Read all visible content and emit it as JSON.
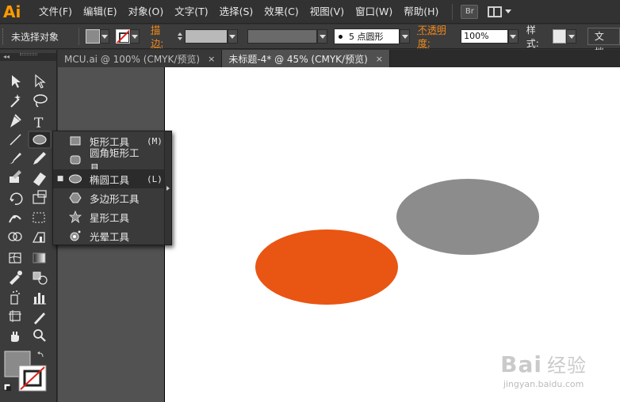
{
  "app": {
    "logo_text": "Ai",
    "accent_color": "#ff9a00"
  },
  "menu": {
    "items": [
      "文件(F)",
      "编辑(E)",
      "对象(O)",
      "文字(T)",
      "选择(S)",
      "效果(C)",
      "视图(V)",
      "窗口(W)",
      "帮助(H)"
    ],
    "bridge_label": "Br"
  },
  "control_bar": {
    "selection_label": "未选择对象",
    "fill_color": "#8a8a8a",
    "stroke_label": "描边:",
    "brush_label": "5 点圆形",
    "opacity_label": "不透明度:",
    "opacity_value": "100%",
    "style_label": "样式:",
    "doc_label": "文档"
  },
  "tabs": [
    {
      "label": "MCU.ai @ 100% (CMYK/预览)",
      "close": "×",
      "active": false
    },
    {
      "label": "未标题-4* @ 45% (CMYK/预览)",
      "close": "×",
      "active": true
    }
  ],
  "toolbox": {
    "collapse_glyph": "◂◂"
  },
  "flyout": {
    "items": [
      {
        "label": "矩形工具",
        "key": "(M)",
        "icon": "rectangle-icon",
        "selected": false
      },
      {
        "label": "圆角矩形工具",
        "key": "",
        "icon": "rounded-rectangle-icon",
        "selected": false
      },
      {
        "label": "椭圆工具",
        "key": "(L)",
        "icon": "ellipse-icon",
        "selected": true
      },
      {
        "label": "多边形工具",
        "key": "",
        "icon": "polygon-icon",
        "selected": false
      },
      {
        "label": "星形工具",
        "key": "",
        "icon": "star-icon",
        "selected": false
      },
      {
        "label": "光晕工具",
        "key": "",
        "icon": "flare-icon",
        "selected": false
      }
    ],
    "selected_bullet": "■"
  },
  "canvas": {
    "gray_ellipse_color": "#8c8c8c",
    "orange_ellipse_color": "#e95513"
  },
  "watermark": {
    "title": "Bai",
    "title_cn": "经验",
    "url": "jingyan.baidu.com"
  }
}
